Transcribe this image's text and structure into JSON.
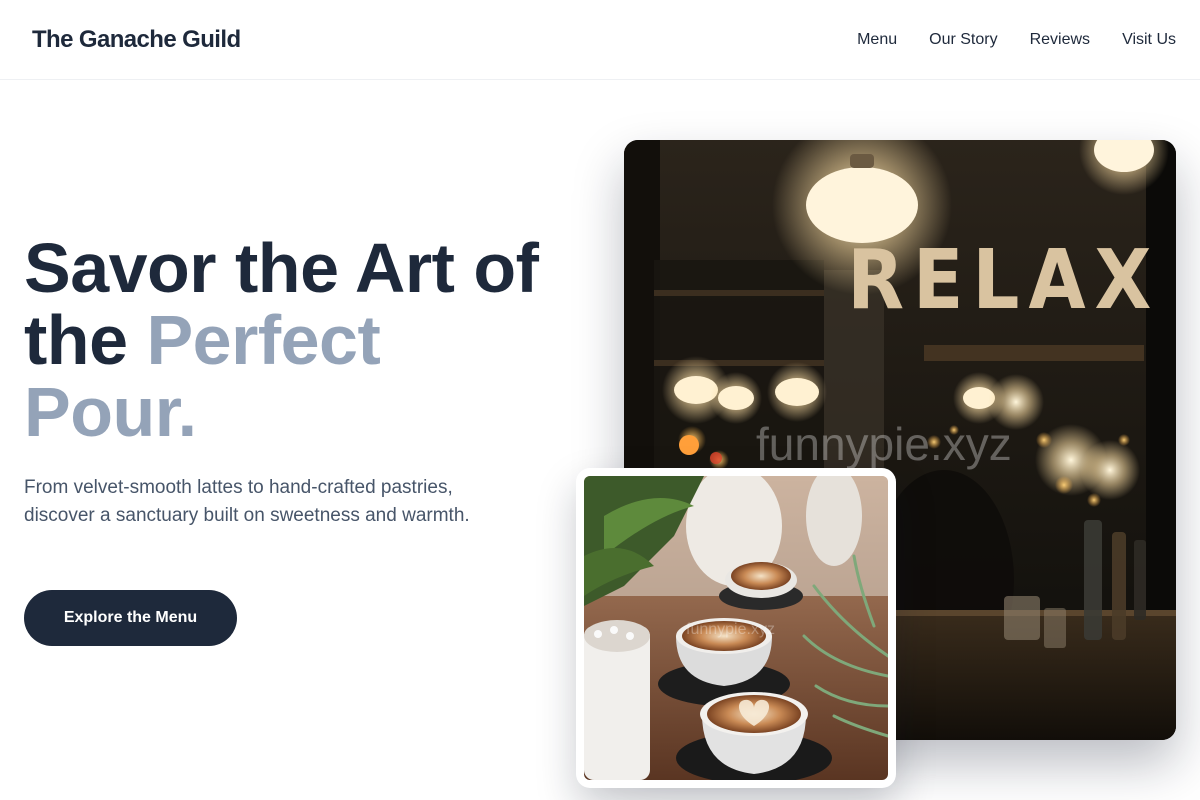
{
  "brand": {
    "name": "The Ganache Guild"
  },
  "nav": {
    "items": [
      {
        "label": "Menu"
      },
      {
        "label": "Our Story"
      },
      {
        "label": "Reviews"
      },
      {
        "label": "Visit Us"
      }
    ]
  },
  "hero": {
    "title_line1": "Savor the Art of",
    "title_line2_dark": "the ",
    "title_line2_accent": "Perfect",
    "title_line3_accent": "Pour.",
    "subtitle": "From velvet-smooth lattes to hand-crafted pastries, discover a sanctuary built on sweetness and warmth.",
    "cta_label": "Explore the Menu"
  },
  "images": {
    "main_sign_text": "RELAX",
    "watermark": "funnypie.xyz"
  },
  "colors": {
    "primary": "#1e293b",
    "accent": "#94a3b8",
    "body_text": "#475569"
  }
}
